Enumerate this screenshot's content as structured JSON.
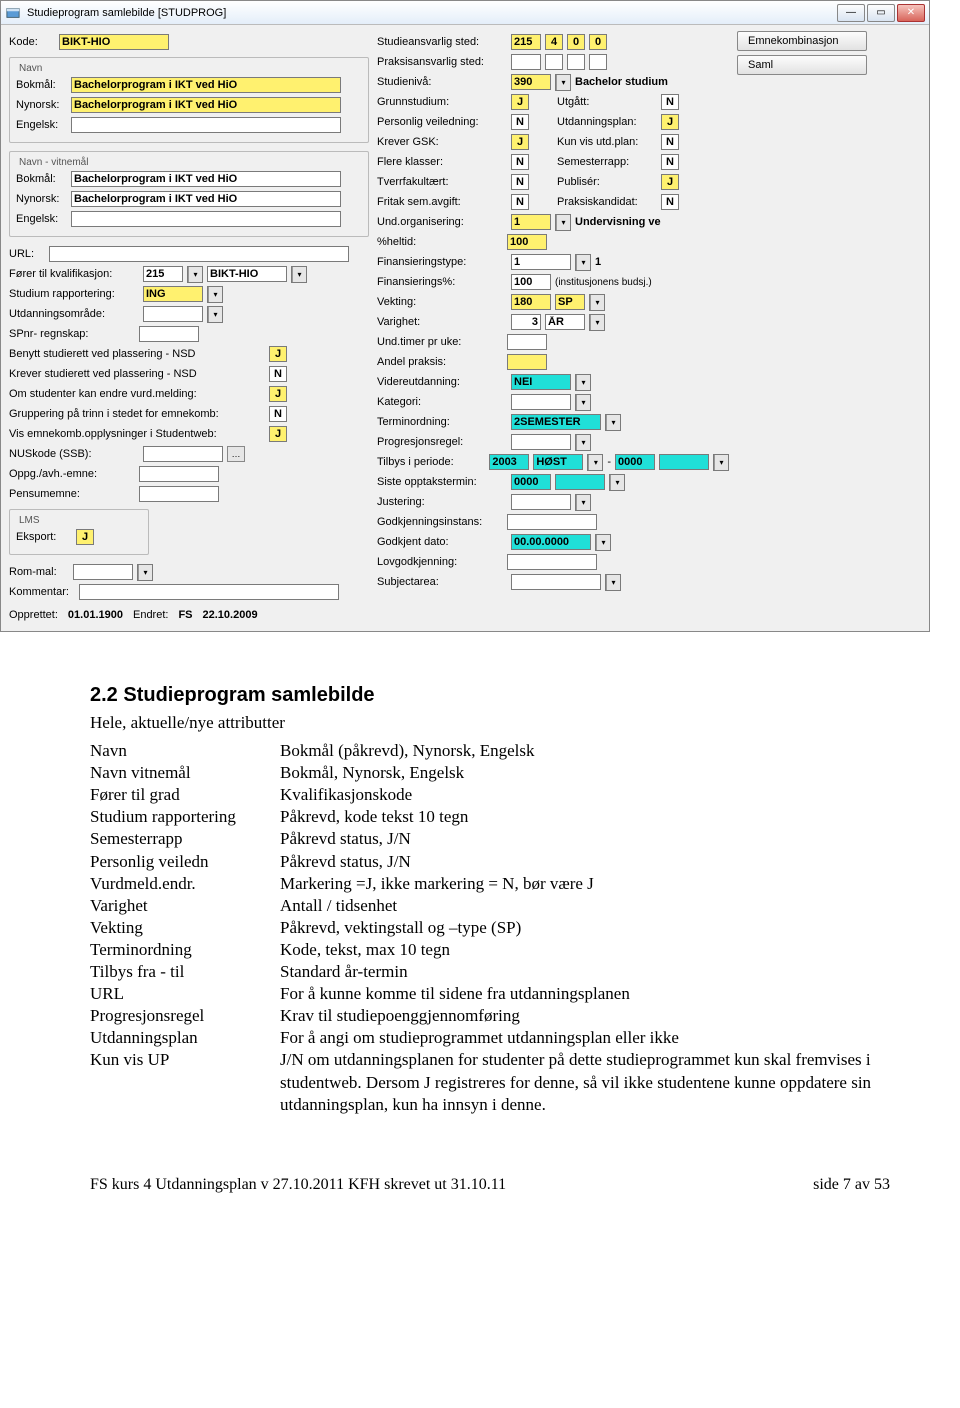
{
  "window": {
    "title": "Studieprogram samlebilde   [STUDPROG]"
  },
  "sidebuttons": {
    "emnekombinasjon": "Emnekombinasjon",
    "saml": "Saml"
  },
  "left": {
    "kode_label": "Kode:",
    "kode": "BIKT-HIO",
    "navn_legend": "Navn",
    "bokmal_label": "Bokmål:",
    "bokmal": "Bachelorprogram i IKT ved HiO",
    "nynorsk_label": "Nynorsk:",
    "nynorsk": "Bachelorprogram i IKT ved HiO",
    "engelsk_label": "Engelsk:",
    "engelsk": "",
    "navnv_legend": "Navn - vitnemål",
    "v_bokmal": "Bachelorprogram i IKT ved HiO",
    "v_nynorsk": "Bachelorprogram i IKT ved HiO",
    "v_engelsk": "",
    "url_label": "URL:",
    "url": "",
    "forer_label": "Fører til kvalifikasjon:",
    "forer_code": "215",
    "forer_name": "BIKT-HIO",
    "stud_rapp_label": "Studium rapportering:",
    "stud_rapp": "ING",
    "utd_omrade_label": "Utdanningsområde:",
    "utd_omrade": "",
    "spnr_label": "SPnr- regnskap:",
    "spnr": "",
    "benytt_label": "Benytt studierett ved plassering - NSD",
    "benytt": "J",
    "krever_label": "Krever studierett ved plassering - NSD",
    "krever": "N",
    "omstud_label": "Om studenter kan endre vurd.melding:",
    "omstud": "J",
    "grupp_label": "Gruppering på trinn i stedet for emnekomb:",
    "grupp": "N",
    "visemne_label": "Vis emnekomb.opplysninger i Studentweb:",
    "visemne": "J",
    "nuskode_label": "NUSkode (SSB):",
    "nuskode": "",
    "oppgav_label": "Oppg./avh.-emne:",
    "oppgav": "",
    "pensum_label": "Pensumemne:",
    "pensum": "",
    "lms_legend": "LMS",
    "eksport_label": "Eksport:",
    "eksport": "J",
    "rommal_label": "Rom-mal:",
    "rommal": "",
    "kommentar_label": "Kommentar:",
    "kommentar": ""
  },
  "footer": {
    "opprettet_label": "Opprettet:",
    "opprettet": "01.01.1900",
    "endret_label": "Endret:",
    "endret_by": "FS",
    "endret_date": "22.10.2009"
  },
  "mid": {
    "studieansvarlig_label": "Studieansvarlig sted:",
    "studieansvarlig": [
      "215",
      "4",
      "0",
      "0"
    ],
    "praksis_label": "Praksisansvarlig sted:",
    "studieniva_label": "Studienivå:",
    "studieniva": "390",
    "studieniva_text": "Bachelor studium",
    "grunn_label": "Grunnstudium:",
    "grunn": "J",
    "utgatt_label": "Utgått:",
    "utgatt": "N",
    "pers_label": "Personlig veiledning:",
    "pers": "N",
    "utdplan_label": "Utdanningsplan:",
    "utdplan": "J",
    "gsk_label": "Krever GSK:",
    "gsk": "J",
    "kunvis_label": "Kun vis utd.plan:",
    "kunvis": "N",
    "klasser_label": "Flere klasser:",
    "klasser": "N",
    "semrapp_label": "Semesterrapp:",
    "semrapp": "N",
    "tverr_label": "Tverrfakultært:",
    "tverr": "N",
    "publiser_label": "Publisér:",
    "publiser": "J",
    "fritak_label": "Fritak sem.avgift:",
    "fritak": "N",
    "praksisk_label": "Praksiskandidat:",
    "praksisk": "N",
    "undorg_label": "Und.organisering:",
    "undorg": "1",
    "undorg_text": "Undervisning ve",
    "heltid_label": "%heltid:",
    "heltid": "100",
    "finanstype_label": "Finansieringstype:",
    "finanstype": "1",
    "finanstype_tail": "1",
    "finpct_label": "Finansierings%:",
    "finpct": "100",
    "finpct_text": "(institusjonens budsj.)",
    "vekting_label": "Vekting:",
    "vekting": "180",
    "vekting_unit": "SP",
    "varighet_label": "Varighet:",
    "varighet": "3",
    "varighet_unit": "ÅR",
    "undtimer_label": "Und.timer pr uke:",
    "undtimer": "",
    "andel_label": "Andel praksis:",
    "andel": "",
    "videre_label": "Videreutdanning:",
    "videre": "NEI",
    "kategori_label": "Kategori:",
    "kategori": "",
    "terminord_label": "Terminordning:",
    "terminord": "2SEMESTER",
    "progresjon_label": "Progresjonsregel:",
    "progresjon": "",
    "tilbys_label": "Tilbys i periode:",
    "tilbys_from_year": "2003",
    "tilbys_from_term": "HØST",
    "tilbys_sep": " - ",
    "tilbys_to_year": "0000",
    "tilbys_to_term": "",
    "siste_label": "Siste opptakstermin:",
    "siste": "0000",
    "just_label": "Justering:",
    "just": "",
    "godkj_label": "Godkjenningsinstans:",
    "godkj": "",
    "godkjdato_label": "Godkjent dato:",
    "godkjdato": "00.00.0000",
    "lov_label": "Lovgodkjenning:",
    "lov": "",
    "subj_label": "Subjectarea:",
    "subj": ""
  },
  "doc": {
    "heading": "2.2 Studieprogram samlebilde",
    "subhead": "Hele, aktuelle/nye attributter",
    "rows": [
      {
        "k": "Navn",
        "v": "Bokmål (påkrevd), Nynorsk, Engelsk"
      },
      {
        "k": "Navn vitnemål",
        "v": "Bokmål, Nynorsk, Engelsk"
      },
      {
        "k": "Fører til grad",
        "v": "Kvalifikasjonskode"
      },
      {
        "k": "Studium rapportering",
        "v": "Påkrevd, kode tekst 10 tegn"
      },
      {
        "k": "Semesterrapp",
        "v": "Påkrevd status, J/N"
      },
      {
        "k": "Personlig veiledn",
        "v": "Påkrevd status, J/N"
      },
      {
        "k": "Vurdmeld.endr.",
        "v": "Markering =J, ikke markering = N, bør være J"
      },
      {
        "k": "Varighet",
        "v": "Antall / tidsenhet"
      },
      {
        "k": "Vekting",
        "v": "Påkrevd, vektingstall og –type (SP)"
      },
      {
        "k": "Terminordning",
        "v": "Kode, tekst, max 10 tegn"
      },
      {
        "k": "Tilbys fra - til",
        "v": "Standard år-termin"
      },
      {
        "k": "URL",
        "v": "For å kunne komme til sidene fra utdanningsplanen"
      },
      {
        "k": "Progresjonsregel",
        "v": "Krav til studiepoenggjennomføring"
      },
      {
        "k": "Utdanningsplan",
        "v": "For å angi om studieprogrammet utdanningsplan eller ikke"
      },
      {
        "k": "Kun vis UP",
        "v": "J/N om utdanningsplanen for studenter på dette studieprogrammet kun skal fremvises i studentweb. Dersom J registreres for denne, så vil ikke studentene kunne oppdatere sin utdanningsplan, kun ha innsyn i denne."
      }
    ],
    "footer_left": "FS kurs 4 Utdanningsplan v 27.10.2011 KFH skrevet ut 31.10.11",
    "footer_right": "side 7 av 53"
  }
}
